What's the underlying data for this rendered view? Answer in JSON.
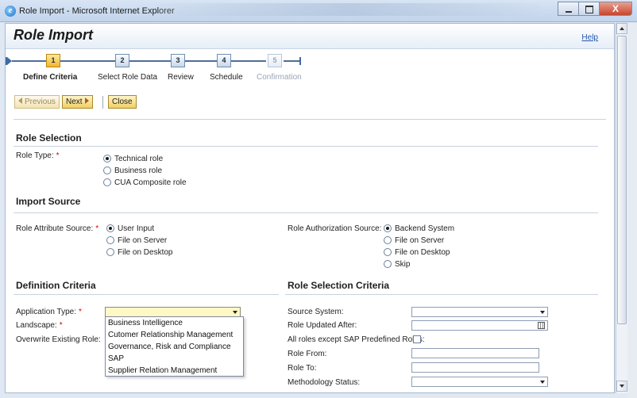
{
  "window": {
    "title": "Role Import - Microsoft Internet Explorer",
    "close_glyph": "X"
  },
  "header": {
    "title": "Role Import",
    "help": "Help"
  },
  "roadmap": {
    "steps": [
      {
        "number": "1",
        "label": "Define Criteria",
        "state": "active"
      },
      {
        "number": "2",
        "label": "Select Role Data",
        "state": "normal"
      },
      {
        "number": "3",
        "label": "Review",
        "state": "normal"
      },
      {
        "number": "4",
        "label": "Schedule",
        "state": "normal"
      },
      {
        "number": "5",
        "label": "Confirmation",
        "state": "disabled"
      }
    ]
  },
  "toolbar": {
    "previous": "Previous",
    "next": "Next",
    "close": "Close"
  },
  "role_selection": {
    "title": "Role Selection",
    "role_type_label": "Role Type:",
    "required_mark": "*",
    "options": [
      {
        "label": "Technical role",
        "selected": true
      },
      {
        "label": "Business role",
        "selected": false
      },
      {
        "label": "CUA Composite role",
        "selected": false
      }
    ]
  },
  "import_source": {
    "title": "Import Source",
    "attribute_label": "Role Attribute Source:",
    "attribute_options": [
      {
        "label": "User Input",
        "selected": true
      },
      {
        "label": "File on Server",
        "selected": false
      },
      {
        "label": "File on Desktop",
        "selected": false
      }
    ],
    "authorization_label": "Role Authorization Source:",
    "authorization_options": [
      {
        "label": "Backend System",
        "selected": true
      },
      {
        "label": "File on Server",
        "selected": false
      },
      {
        "label": "File on Desktop",
        "selected": false
      },
      {
        "label": "Skip",
        "selected": false
      }
    ]
  },
  "definition_criteria": {
    "title": "Definition Criteria",
    "application_type_label": "Application Type:",
    "application_type_value": "",
    "landscape_label": "Landscape:",
    "overwrite_label": "Overwrite Existing Role:",
    "application_type_options": [
      "Business Intelligence",
      "Cutomer Relationship Management",
      "Governance, Risk and Compliance",
      "SAP",
      "Supplier Relation Management"
    ]
  },
  "role_selection_criteria": {
    "title": "Role Selection Criteria",
    "source_system_label": "Source System:",
    "role_updated_after_label": "Role Updated After:",
    "all_roles_label": "All roles except SAP Predefined Roles:",
    "all_roles_checked": false,
    "role_from_label": "Role From:",
    "role_to_label": "Role To:",
    "methodology_status_label": "Methodology Status:"
  },
  "colors": {
    "active_step": "#f3b52d",
    "button_yellow": "#f1cf63",
    "required": "#d10000",
    "link": "#2556a8"
  }
}
